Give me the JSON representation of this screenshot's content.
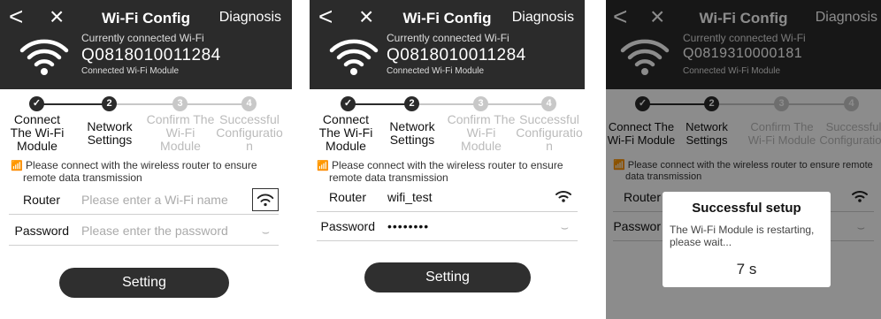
{
  "screens": [
    {
      "header": {
        "back": "<",
        "close": "×",
        "title": "Wi-Fi Config",
        "diagnosis": "Diagnosis",
        "subtitle": "Currently connected Wi-Fi",
        "device_id": "Q0818010011284",
        "module_status": "Connected Wi-Fi Module"
      },
      "steps": [
        {
          "num": "✓",
          "l1": "Connect",
          "l2": "The Wi-Fi",
          "l3": "Module"
        },
        {
          "num": "2",
          "l1": "Network",
          "l2": "Settings",
          "l3": ""
        },
        {
          "num": "3",
          "l1": "Confirm The",
          "l2": "Wi-Fi",
          "l3": "Module"
        },
        {
          "num": "4",
          "l1": "Successful",
          "l2": "Configuratio",
          "l3": "n"
        }
      ],
      "note": {
        "line1": "Please connect with the wireless router to ensure",
        "line2": "remote data transmission"
      },
      "router": {
        "label": "Router",
        "placeholder": "Please enter a Wi-Fi name"
      },
      "password": {
        "label": "Password",
        "placeholder": "Please enter the password"
      },
      "setting_button": "Setting"
    },
    {
      "header": {
        "back": "<",
        "close": "×",
        "title": "Wi-Fi Config",
        "diagnosis": "Diagnosis",
        "subtitle": "Currently connected Wi-Fi",
        "device_id": "Q0818010011284",
        "module_status": "Connected Wi-Fi Module"
      },
      "steps": [
        {
          "num": "✓",
          "l1": "Connect",
          "l2": "The Wi-Fi",
          "l3": "Module"
        },
        {
          "num": "2",
          "l1": "Network",
          "l2": "Settings",
          "l3": ""
        },
        {
          "num": "3",
          "l1": "Confirm The",
          "l2": "Wi-Fi",
          "l3": "Module"
        },
        {
          "num": "4",
          "l1": "Successful",
          "l2": "Configuratio",
          "l3": "n"
        }
      ],
      "note": {
        "line1": "Please connect with the wireless router to ensure",
        "line2": "remote data transmission"
      },
      "router": {
        "label": "Router",
        "value": "wifi_test"
      },
      "password": {
        "label": "Password",
        "value": "••••••••"
      },
      "setting_button": "Setting"
    },
    {
      "header": {
        "back": "<",
        "close": "×",
        "title": "Wi-Fi Config",
        "diagnosis": "Diagnosis",
        "subtitle": "Currently connected Wi-Fi",
        "device_id": "Q0819310000181",
        "module_status": "Connected Wi-Fi Module"
      },
      "steps": [
        {
          "num": "✓",
          "l1": "Connect The",
          "l2": "Wi-Fi Module",
          "l3": ""
        },
        {
          "num": "2",
          "l1": "Network",
          "l2": "Settings",
          "l3": ""
        },
        {
          "num": "3",
          "l1": "Confirm The",
          "l2": "Wi-Fi Module",
          "l3": ""
        },
        {
          "num": "4",
          "l1": "Successful",
          "l2": "Configuration",
          "l3": ""
        }
      ],
      "note": {
        "line1": "Please connect with the wireless router to ensure remote",
        "line2": "data transmission"
      },
      "router": {
        "label": "Router"
      },
      "password": {
        "label": "Passwor"
      },
      "dialog": {
        "title": "Successful setup",
        "message": "The Wi-Fi Module is restarting, please wait...",
        "countdown": "7 s"
      }
    }
  ],
  "colors": {
    "header_bg": "#2b2b2b",
    "step_active": "#2b2b2b",
    "step_inactive": "#c8c8c8",
    "button_bg": "#2f2f2f"
  }
}
